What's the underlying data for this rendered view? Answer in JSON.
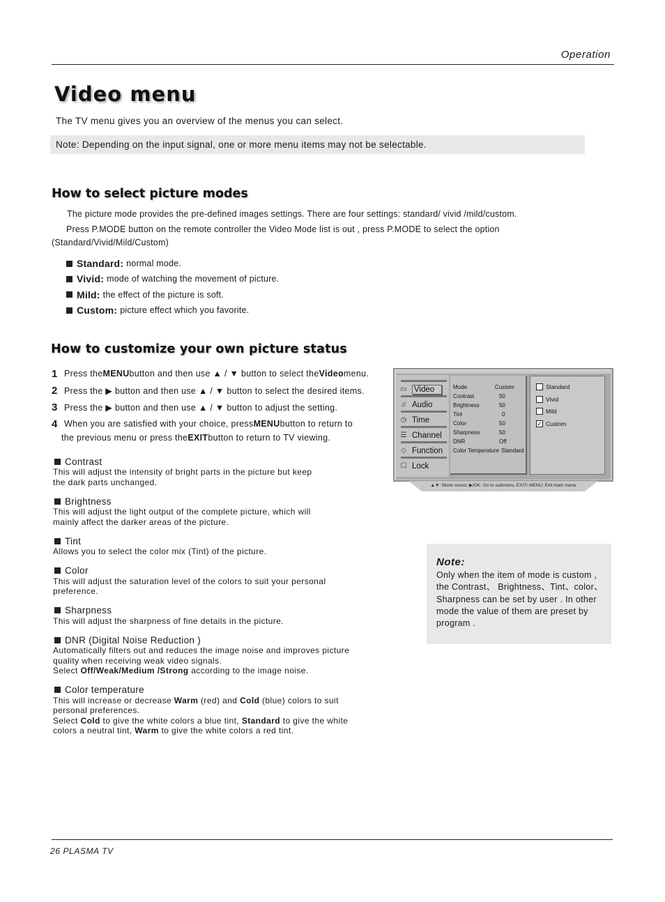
{
  "header": {
    "section": "Operation"
  },
  "page": {
    "title": "Video menu",
    "intro": "The TV menu gives you an overview of the menus you can select.",
    "note": "Note: Depending on the input signal, one or more menu items may not be selectable."
  },
  "picture_modes": {
    "heading": "How to select picture modes",
    "para1": "The picture mode provides the pre-defined images settings. There are four settings: standard/ vivid /mild/custom.",
    "para2": "Press  P.MODE button on the remote controller the Video Mode list is out , press P.MODE to select the option (Standard/Vivid/Mild/Custom)",
    "modes": [
      {
        "name": "Standard:",
        "desc": "normal mode."
      },
      {
        "name": "Vivid:",
        "desc": "mode of watching the movement of picture."
      },
      {
        "name": "Mild:",
        "desc": "the effect of the picture is soft."
      },
      {
        "name": "Custom:",
        "desc": "picture effect which you favorite."
      }
    ]
  },
  "customize": {
    "heading": "How to customize your own picture status",
    "steps": [
      {
        "num": "1",
        "parts": [
          "Press the ",
          "MENU",
          " button and then use ▲ / ▼ button to select the ",
          "Video",
          " menu."
        ]
      },
      {
        "num": "2",
        "parts": [
          "Press the ▶ button and then use ▲ / ▼ button to select the desired items."
        ]
      },
      {
        "num": "3",
        "parts": [
          "Press the ▶ button and then use ▲ / ▼ button to adjust the setting."
        ]
      },
      {
        "num": "4",
        "parts": [
          "When you are satisfied with your choice,  press ",
          "MENU",
          " button to return to"
        ]
      },
      {
        "num": "",
        "parts": [
          "the previous menu or press the ",
          "EXIT",
          " button to return to TV viewing."
        ]
      }
    ],
    "items": [
      {
        "title": "Contrast",
        "desc": [
          "This will adjust the intensity of bright parts in the picture but keep",
          "the dark parts unchanged."
        ]
      },
      {
        "title": "Brightness",
        "desc": [
          "This will adjust the light output of the complete picture, which will",
          "mainly affect the darker areas of the picture."
        ]
      },
      {
        "title": "Tint",
        "desc": [
          "Allows you to select the color mix (Tint) of the picture."
        ]
      },
      {
        "title": "Color",
        "desc": [
          "This will adjust the saturation level of the colors to suit your personal",
          "preference."
        ]
      },
      {
        "title": "Sharpness",
        "desc": [
          "This will adjust the sharpness of fine details in the picture."
        ]
      },
      {
        "title": "DNR (Digital Noise Reduction )",
        "desc": [
          "Automatically filters out and reduces the image noise and improves picture",
          "quality when receiving weak video signals.",
          "Select |Off/Weak/Medium /Strong| according to the image noise."
        ]
      },
      {
        "title": "Color temperature",
        "desc": [
          "This will increase or decrease |Warm| (red) and |Cold| (blue) colors to suit",
          "personal preferences.",
          "Select |Cold| to give the white colors a blue tint, |Standard| to give the white",
          "colors a neutral tint, |Warm| to give the white colors a red tint."
        ]
      }
    ]
  },
  "osd": {
    "menu": [
      {
        "label": "Video",
        "icon": "video-icon",
        "glyph": "▭",
        "selected": true
      },
      {
        "label": "Audio",
        "icon": "audio-icon",
        "glyph": "♫",
        "selected": false
      },
      {
        "label": "Time",
        "icon": "clock-icon",
        "glyph": "◷",
        "selected": false
      },
      {
        "label": "Channel",
        "icon": "channel-icon",
        "glyph": "☰",
        "selected": false
      },
      {
        "label": "Function",
        "icon": "function-icon",
        "glyph": "◇",
        "selected": false
      },
      {
        "label": "Lock",
        "icon": "lock-icon",
        "glyph": "☐",
        "selected": false
      }
    ],
    "settings": [
      {
        "name": "Mode",
        "value": "Custom"
      },
      {
        "name": "Contrast",
        "value": "50"
      },
      {
        "name": "Brightness",
        "value": "50"
      },
      {
        "name": "Tint",
        "value": "0"
      },
      {
        "name": "Color",
        "value": "50"
      },
      {
        "name": "Sharpness",
        "value": "50"
      },
      {
        "name": "DNR",
        "value": "Off"
      },
      {
        "name": "Color Temperature",
        "value": "Standard"
      }
    ],
    "options": [
      {
        "label": "Standard",
        "checked": false
      },
      {
        "label": "Vivid",
        "checked": false
      },
      {
        "label": "Mild",
        "checked": false
      },
      {
        "label": "Custom",
        "checked": true
      }
    ],
    "footer": "▲▼: Move cursor,  ▶/OK: Go to submenu, EXIT/ MENU: Exit main menu"
  },
  "note_box": {
    "title": "Note:",
    "body": "Only when the item of mode is custom , the Contrast、 Brightness、Tint、color、Sharpness can be set by user . In other mode the value of them are preset by program ."
  },
  "footer": {
    "text": "26  PLASMA TV"
  }
}
